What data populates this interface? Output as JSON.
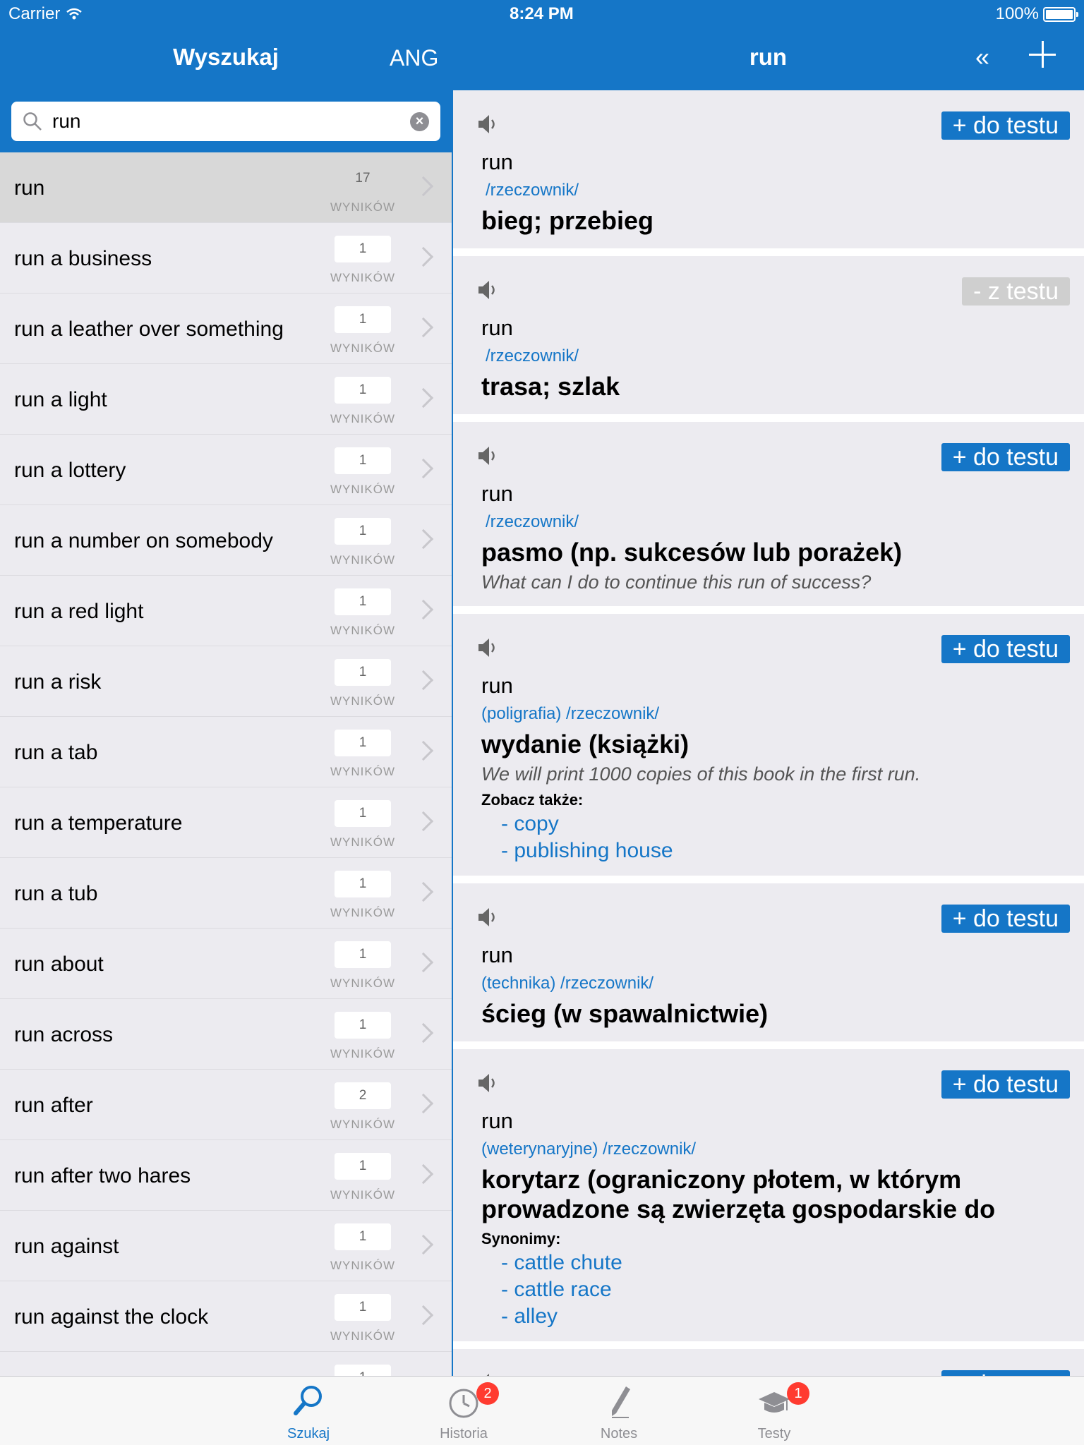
{
  "status": {
    "carrier": "Carrier",
    "time": "8:24 PM",
    "battery": "100%"
  },
  "nav": {
    "left_title": "Wyszukaj",
    "lang": "ANG",
    "right_title": "run",
    "back_label": "«"
  },
  "search": {
    "value": "run",
    "placeholder": ""
  },
  "results_sub": "WYNIKÓW",
  "results": [
    {
      "label": "run",
      "count": "17"
    },
    {
      "label": "run a business",
      "count": "1"
    },
    {
      "label": "run a leather over something",
      "count": "1"
    },
    {
      "label": "run a light",
      "count": "1"
    },
    {
      "label": "run a lottery",
      "count": "1"
    },
    {
      "label": "run a number on somebody",
      "count": "1"
    },
    {
      "label": "run a red light",
      "count": "1"
    },
    {
      "label": "run a risk",
      "count": "1"
    },
    {
      "label": "run a tab",
      "count": "1"
    },
    {
      "label": "run a temperature",
      "count": "1"
    },
    {
      "label": "run a tub",
      "count": "1"
    },
    {
      "label": "run about",
      "count": "1"
    },
    {
      "label": "run across",
      "count": "1"
    },
    {
      "label": "run after",
      "count": "2"
    },
    {
      "label": "run after two hares",
      "count": "1"
    },
    {
      "label": "run against",
      "count": "1"
    },
    {
      "label": "run against the clock",
      "count": "1"
    },
    {
      "label": "",
      "count": "1"
    }
  ],
  "buttons": {
    "add": "+ do testu",
    "remove": "- z testu"
  },
  "entries": [
    {
      "head": "run",
      "pos": "/rzeczownik/",
      "trans": "bieg; przebieg"
    },
    {
      "head": "run",
      "pos": "/rzeczownik/",
      "trans": "trasa; szlak"
    },
    {
      "head": "run",
      "pos": "/rzeczownik/",
      "trans": "pasmo (np. sukcesów lub porażek)",
      "example": "What can I do to continue this run of success?"
    },
    {
      "head": "run",
      "pos": "(poligrafia) /rzeczownik/",
      "trans": "wydanie (książki)",
      "example": "We will print 1000 copies of this book in the first run.",
      "see_label": "Zobacz także:",
      "links": [
        "- copy",
        "- publishing house"
      ]
    },
    {
      "head": "run",
      "pos": "(technika) /rzeczownik/",
      "trans": "ścieg (w spawalnictwie)"
    },
    {
      "head": "run",
      "pos": "(weterynaryjne) /rzeczownik/",
      "trans": "korytarz (ograniczony płotem, w którym prowadzone są zwierzęta gospodarskie do",
      "syn_label": "Synonimy:",
      "links": [
        "- cattle chute",
        "- cattle race",
        "- alley"
      ]
    }
  ],
  "tabs": [
    {
      "label": "Szukaj",
      "badge": ""
    },
    {
      "label": "Historia",
      "badge": "2"
    },
    {
      "label": "Notes",
      "badge": ""
    },
    {
      "label": "Testy",
      "badge": "1"
    }
  ],
  "colors": {
    "accent": "#1576c7",
    "badge": "#ff3b30",
    "remove_button": "#cfcfcf"
  },
  "icons": {
    "search": "magnifier-icon",
    "speaker": "speaker-icon",
    "history": "clock-icon",
    "notes": "pen-icon",
    "tests": "graduation-cap-icon"
  }
}
